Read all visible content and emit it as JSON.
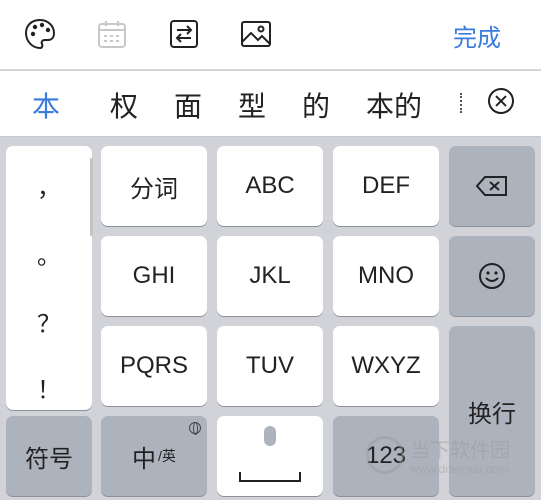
{
  "toolbar": {
    "icons": [
      "palette-icon",
      "calendar-icon",
      "switch-arrows-icon",
      "image-icon"
    ],
    "done_label": "完成"
  },
  "candidates": {
    "items": [
      "本",
      "权",
      "面",
      "型",
      "的",
      "本的"
    ],
    "close_icon": "close-circle-icon"
  },
  "keyboard": {
    "punctuation": [
      "，",
      "。",
      "？",
      "！"
    ],
    "rows": [
      [
        "分词",
        "ABC",
        "DEF"
      ],
      [
        "GHI",
        "JKL",
        "MNO"
      ],
      [
        "PQRS",
        "TUV",
        "WXYZ"
      ]
    ],
    "backspace_icon": "backspace-icon",
    "emoji_icon": "smiley-icon",
    "enter_label": "换行",
    "symbols_label": "符号",
    "lang_main": "中",
    "lang_alt": "/英",
    "globe_icon": "globe-icon",
    "mic_icon": "mic-icon",
    "numbers_label": "123"
  },
  "watermark": {
    "name": "当下软件园",
    "url": "www.downxia.com"
  },
  "colors": {
    "accent": "#3a7be0",
    "keyboard_bg": "#d1d3d9",
    "key_dark": "#adb3bd"
  }
}
